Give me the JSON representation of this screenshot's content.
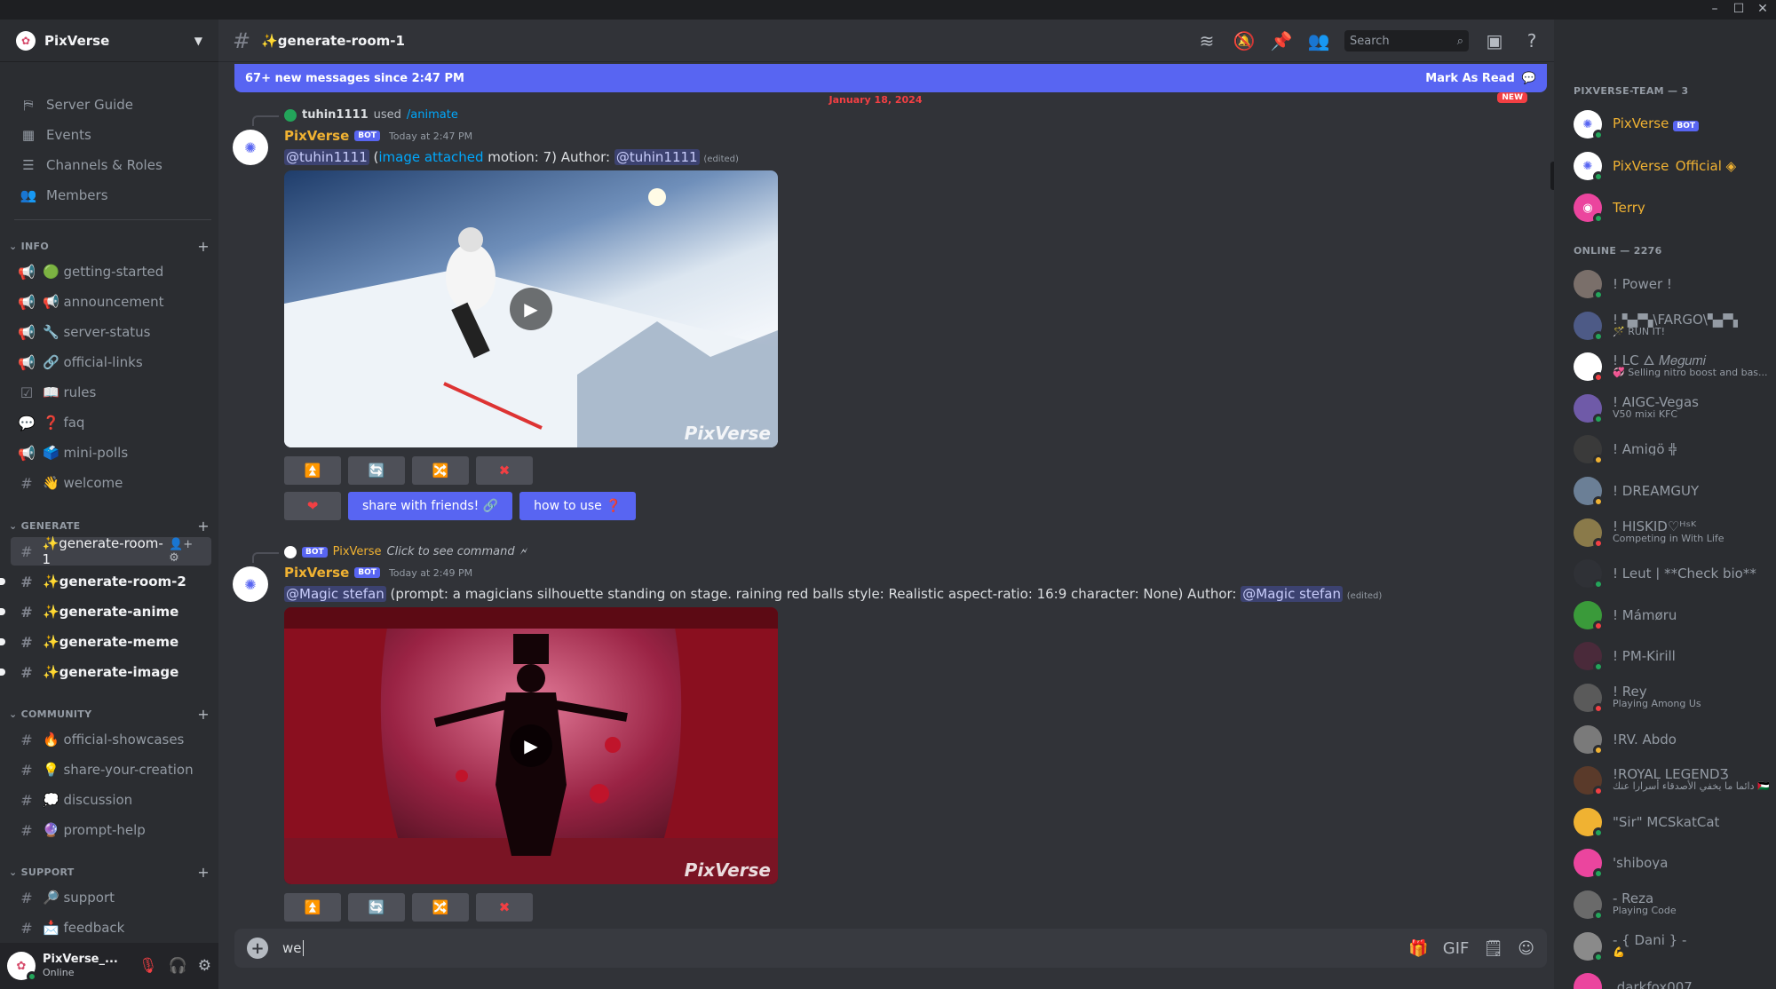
{
  "window": {
    "min": "–",
    "max": "☐",
    "close": "✕"
  },
  "server": {
    "name": "PixVerse"
  },
  "nav": [
    {
      "label": "Server Guide",
      "icon": "signpost-icon"
    },
    {
      "label": "Events",
      "icon": "calendar-icon"
    },
    {
      "label": "Channels & Roles",
      "icon": "channel-browse-icon"
    },
    {
      "label": "Members",
      "icon": "members-icon"
    }
  ],
  "categories": {
    "info": "INFO",
    "generate": "GENERATE",
    "community": "COMMUNITY",
    "support": "SUPPORT"
  },
  "channels": {
    "info": [
      {
        "label": "🟢 getting-started"
      },
      {
        "label": "📢 announcement"
      },
      {
        "label": "🔧 server-status"
      },
      {
        "label": "🔗 official-links"
      },
      {
        "label": "📖 rules"
      },
      {
        "label": "❓ faq"
      },
      {
        "label": "🗳️ mini-polls"
      },
      {
        "label": "👋 welcome"
      }
    ],
    "generate": [
      {
        "label": "✨generate-room-1"
      },
      {
        "label": "✨generate-room-2"
      },
      {
        "label": "✨generate-anime"
      },
      {
        "label": "✨generate-meme"
      },
      {
        "label": "✨generate-image"
      }
    ],
    "community": [
      {
        "label": "🔥 official-showcases"
      },
      {
        "label": "💡 share-your-creation"
      },
      {
        "label": "💭 discussion"
      },
      {
        "label": "🔮 prompt-help"
      }
    ],
    "support": [
      {
        "label": "🔎 support"
      },
      {
        "label": "📩 feedback"
      }
    ]
  },
  "user": {
    "name": "PixVerse_...",
    "status": "Online"
  },
  "channel_header": {
    "name": "✨generate-room-1",
    "search_placeholder": "Search"
  },
  "banner": {
    "text": "67+ new messages since 2:47 PM",
    "action": "Mark As Read"
  },
  "date_divider": {
    "date": "January 18, 2024",
    "new": "NEW"
  },
  "messages": [
    {
      "reply_user": "tuhin1111",
      "reply_used": "used",
      "reply_command": "/animate",
      "author": "PixVerse",
      "bot": "BOT",
      "time": "Today at 2:47 PM",
      "mention1": "@tuhin1111",
      "text_a": " (",
      "link": "image attached",
      "text_b": " motion: 7) Author: ",
      "mention2": "@tuhin1111",
      "edited": "(edited)",
      "watermark": "PixVerse",
      "btn_share": "share with friends! 🔗",
      "btn_howto": "how to use ❓"
    },
    {
      "reply_bot": "BOT",
      "reply_user": "PixVerse",
      "reply_command": "Click to see command",
      "author": "PixVerse",
      "bot": "BOT",
      "time": "Today at 2:49 PM",
      "mention1": "@Magic stefan",
      "text_a": " (prompt: a magicians silhouette standing on stage. raining red balls style: Realistic aspect-ratio: 16:9 character: None) Author: ",
      "mention2": "@Magic stefan",
      "edited": "(edited)",
      "watermark": "PixVerse"
    }
  ],
  "composer": {
    "text": "we"
  },
  "members": {
    "team_header": "PIXVERSE-TEAM — 3",
    "online_header": "ONLINE — 2276",
    "team": [
      {
        "name": "PixVerse",
        "badge": "BOT",
        "color": "#f0b232"
      },
      {
        "name": "PixVerse_Official ◈",
        "color": "#f0b232"
      },
      {
        "name": "Terry",
        "color": "#f0b232"
      }
    ],
    "online": [
      {
        "name": "! Power !",
        "sub": ""
      },
      {
        "name": "! ▚▞▚\\FARGO\\▚▞▚",
        "sub": "🪄 RUN IT!"
      },
      {
        "name": "! LC 🜂 𝑀𝑒𝑔𝑢𝑚𝑖",
        "sub": "💞 Selling nitro boost and bas..."
      },
      {
        "name": "! AIGC-Vegas",
        "sub": "V50 mixi KFC"
      },
      {
        "name": "! Amigö ╬",
        "sub": ""
      },
      {
        "name": "! DREAMGUY",
        "sub": ""
      },
      {
        "name": "! HISKID♡ᴴˢᴷ",
        "sub": "Competing in With Life"
      },
      {
        "name": "! Leut | **Check bio**",
        "sub": ""
      },
      {
        "name": "! Mámøru",
        "sub": ""
      },
      {
        "name": "! PM-Kirill",
        "sub": ""
      },
      {
        "name": "! Rey",
        "sub": "Playing Among Us"
      },
      {
        "name": "!RV. Abdo",
        "sub": ""
      },
      {
        "name": "!ROYAL LEGENDƷ",
        "sub": "دائما ما يخفي الأصدقاء أسرارا عنك 🇵🇸"
      },
      {
        "name": "\"Sir\" MCSkatCat",
        "sub": ""
      },
      {
        "name": "'shiboya",
        "sub": ""
      },
      {
        "name": "- Reza",
        "sub": "Playing Code"
      },
      {
        "name": "- { Dani } -",
        "sub": "💪"
      },
      {
        "name": ".darkfox007",
        "sub": ""
      }
    ]
  },
  "colors": {
    "accent": "#5865f2",
    "bot_name": "#f0b232",
    "online": "#23a55a",
    "dnd": "#f23f43"
  }
}
